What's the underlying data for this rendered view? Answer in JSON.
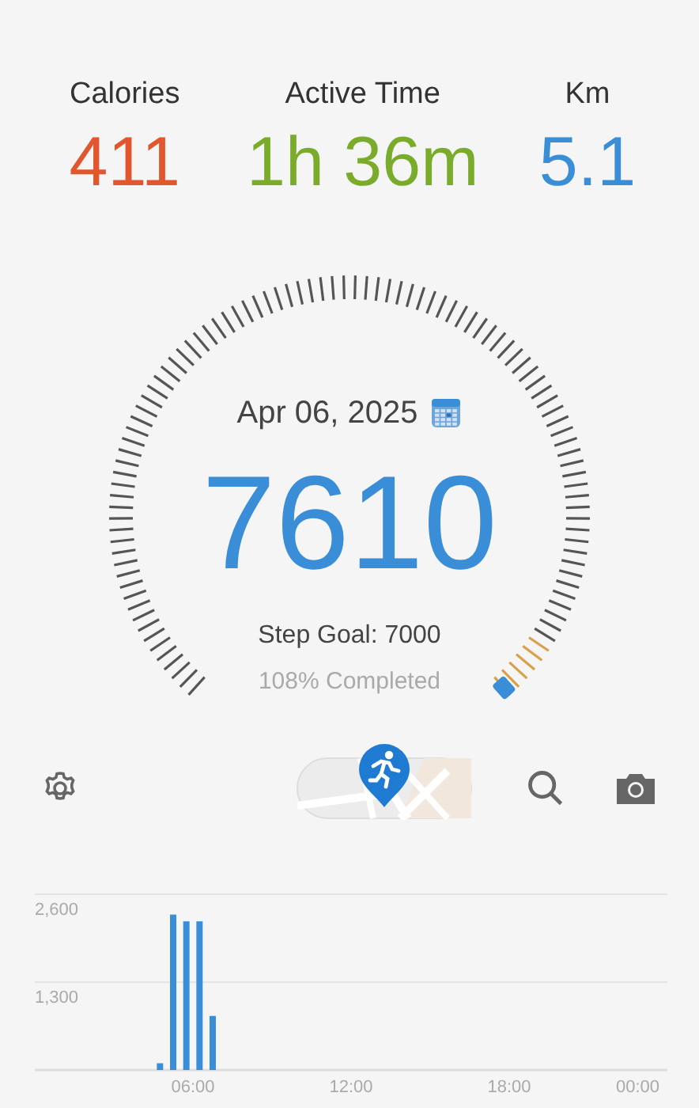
{
  "stats": [
    {
      "label": "Calories",
      "value": "411",
      "color": "#e2562d"
    },
    {
      "label": "Active Time",
      "value": "1h 36m",
      "color": "#7aab2a"
    },
    {
      "label": "Km",
      "value": "5.1",
      "color": "#3a8ed8"
    }
  ],
  "gauge": {
    "date": "Apr 06, 2025",
    "steps": "7610",
    "goal": "Step Goal: 7000",
    "completed": "108% Completed"
  },
  "chart_data": {
    "type": "bar",
    "x": [
      4.75,
      5.25,
      5.75,
      6.25,
      6.75
    ],
    "values": [
      100,
      2300,
      2200,
      2200,
      800
    ],
    "xlim": [
      0,
      24
    ],
    "ylim": [
      0,
      2600
    ],
    "xticks": [
      {
        "value": 6,
        "label": "06:00"
      },
      {
        "value": 12,
        "label": "12:00"
      },
      {
        "value": 18,
        "label": "18:00"
      },
      {
        "value": 24,
        "label": "00:00"
      }
    ],
    "yticks": [
      {
        "value": 1300,
        "label": "1,300"
      },
      {
        "value": 2600,
        "label": "2,600"
      }
    ]
  }
}
